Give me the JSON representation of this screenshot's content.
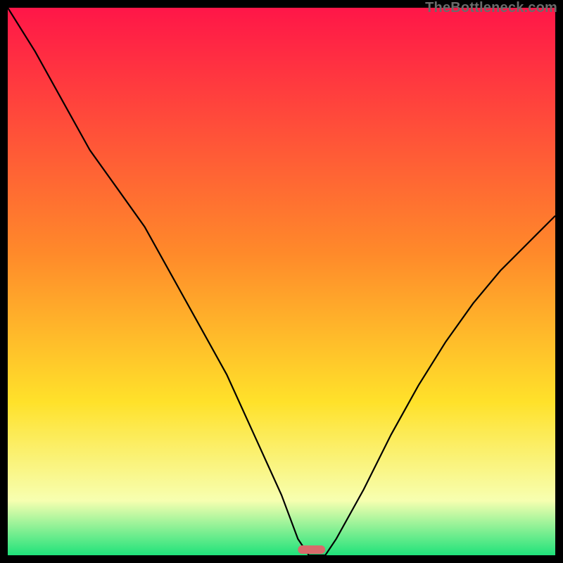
{
  "watermark": "TheBottleneck.com",
  "colors": {
    "frame_bg": "#000000",
    "gradient_top": "#ff1648",
    "gradient_mid1": "#ff8a2a",
    "gradient_mid2": "#ffe12a",
    "gradient_low": "#f7ffb0",
    "gradient_bottom": "#1fe27a",
    "curve": "#000000",
    "marker": "#d86b6b"
  },
  "chart_data": {
    "type": "line",
    "title": "",
    "xlabel": "",
    "ylabel": "",
    "xlim": [
      0,
      100
    ],
    "ylim": [
      0,
      100
    ],
    "curve": {
      "name": "bottleneck",
      "x": [
        0,
        5,
        10,
        15,
        20,
        25,
        30,
        35,
        40,
        45,
        50,
        53,
        55,
        58,
        60,
        65,
        70,
        75,
        80,
        85,
        90,
        95,
        100
      ],
      "y": [
        100,
        92,
        83,
        74,
        67,
        60,
        51,
        42,
        33,
        22,
        11,
        3,
        0,
        0,
        3,
        12,
        22,
        31,
        39,
        46,
        52,
        57,
        62
      ]
    },
    "marker": {
      "x_start": 53,
      "x_end": 58,
      "y": 0
    },
    "background_gradient_stops": [
      {
        "pct": 0,
        "color": "#ff1648"
      },
      {
        "pct": 45,
        "color": "#ff8a2a"
      },
      {
        "pct": 72,
        "color": "#ffe12a"
      },
      {
        "pct": 90,
        "color": "#f7ffb0"
      },
      {
        "pct": 100,
        "color": "#1fe27a"
      }
    ]
  }
}
